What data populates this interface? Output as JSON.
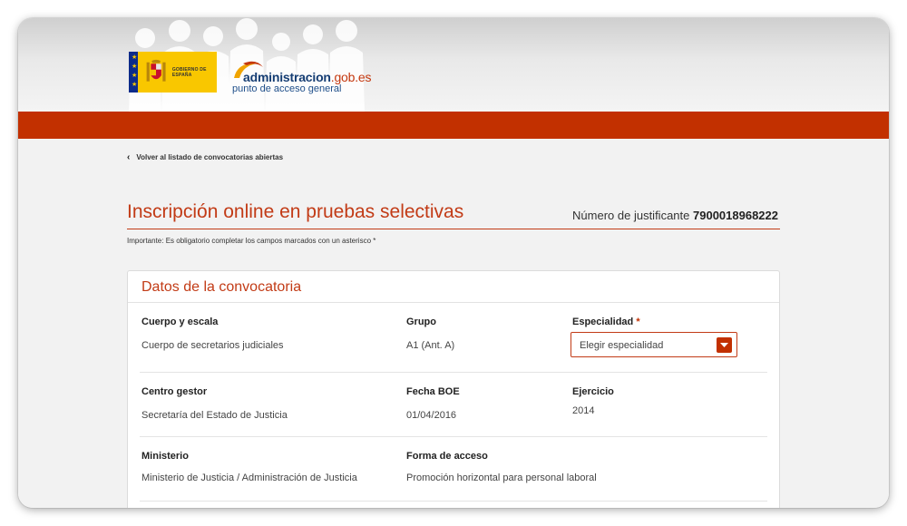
{
  "header": {
    "gov_logo_text": "Gobierno de España",
    "portal_name_main": "administracion",
    "portal_name_domain": ".gob.es",
    "portal_tagline": "punto de acceso general"
  },
  "nav": {
    "back_link": "Volver al listado de convocatorias abiertas"
  },
  "page": {
    "title": "Inscripción online en pruebas selectivas",
    "receipt_label": "Número de justificante",
    "receipt_number": "7900018968222",
    "required_note": "Importante: Es obligatorio completar los campos marcados con un asterisco *"
  },
  "section": {
    "title": "Datos de la convocatoria",
    "fields": {
      "cuerpo": {
        "label": "Cuerpo y escala",
        "value": "Cuerpo de secretarios judiciales"
      },
      "grupo": {
        "label": "Grupo",
        "value": "A1 (Ant. A)"
      },
      "especialidad": {
        "label": "Especialidad",
        "required_mark": "*",
        "selected": "Elegir especialidad"
      },
      "centro": {
        "label": "Centro gestor",
        "value": "Secretaría del Estado de Justicia"
      },
      "fecha": {
        "label": "Fecha BOE",
        "value": "01/04/2016"
      },
      "ejercicio": {
        "label": "Ejercicio",
        "value": "2014"
      },
      "ministerio": {
        "label": "Ministerio",
        "value": "Ministerio de Justicia / Administración de Justicia"
      },
      "forma": {
        "label": "Forma de acceso",
        "value": "Promoción horizontal para personal laboral"
      }
    }
  },
  "colors": {
    "brand_red": "#c23000",
    "title_red": "#c23b16",
    "gov_yellow": "#f9c700",
    "gov_blue": "#0c2b8a"
  },
  "icons": {
    "back": "chevron-left-icon",
    "dropdown": "caret-down-icon"
  }
}
